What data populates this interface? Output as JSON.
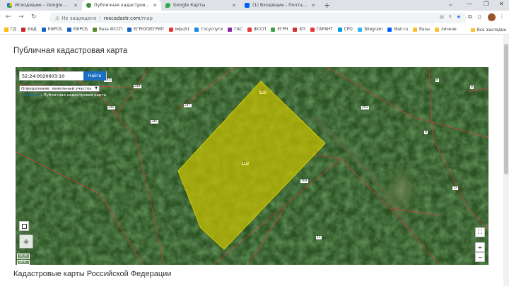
{
  "tabs": [
    {
      "label": "Исходящие – Google Диск",
      "color": "#1a73e8"
    },
    {
      "label": "Публичная кадастровая карта",
      "color": "#3d8f46"
    },
    {
      "label": "Google Карты",
      "color": "#34a853"
    },
    {
      "label": "(1) Входящие - Почта Mail.ru",
      "color": "#005ff9"
    }
  ],
  "address": {
    "not_secure": "Не защищено",
    "host": "roscadastr.com",
    "path": "/map"
  },
  "bookmarks": [
    {
      "label": "ГД",
      "color": "#fbbc04"
    },
    {
      "label": "КАД",
      "color": "#c62828"
    },
    {
      "label": "ЕФРСБ",
      "color": "#1565c0"
    },
    {
      "label": "ЕФРСБ",
      "color": "#1565c0"
    },
    {
      "label": "база ФССП",
      "color": "#558b2f"
    },
    {
      "label": "ЕГРЮЛ/ЕГРИП",
      "color": "#1565c0"
    },
    {
      "label": "мфц51",
      "color": "#e53935"
    },
    {
      "label": "Госуслуги",
      "color": "#1e88e5"
    },
    {
      "label": "ГАС",
      "color": "#8e24aa"
    },
    {
      "label": "ФССП",
      "color": "#e53935"
    },
    {
      "label": "ЕГРН",
      "color": "#43a047"
    },
    {
      "label": "КП",
      "color": "#d32f2f"
    },
    {
      "label": "ГАРАНТ",
      "color": "#e53935"
    },
    {
      "label": "СРО",
      "color": "#039be5"
    },
    {
      "label": "Telegram",
      "color": "#29b6f6"
    },
    {
      "label": "Mail.ru",
      "color": "#005ff9"
    },
    {
      "label": "базы",
      "color": "#fbc02d"
    },
    {
      "label": "личное",
      "color": "#fbc02d"
    }
  ],
  "bookmarks_all": "Все закладки",
  "page": {
    "title": "Публичная кадастровая карта",
    "section_title": "Кадастровые карты Российской Федерации"
  },
  "map": {
    "search_value": "52:24:0020603:10",
    "find_button": "Найти",
    "definition_label": "Определение:",
    "definition_value": "земельный участок",
    "breadcrumb_home": "Главная",
    "breadcrumb_current": "Публичная кадастровая карта",
    "labels": [
      "345",
      "248",
      "247",
      "246",
      "283",
      "8",
      "8",
      "8",
      "10",
      "10",
      "164",
      "12",
      "11"
    ],
    "scale": [
      "50 m",
      "50 ft"
    ],
    "zoom_in": "+",
    "zoom_out": "−"
  },
  "colors": {
    "parcel": "#c8c000",
    "boundary": "#e53935",
    "forest": "#264a20",
    "accent": "#1b6ec2"
  }
}
